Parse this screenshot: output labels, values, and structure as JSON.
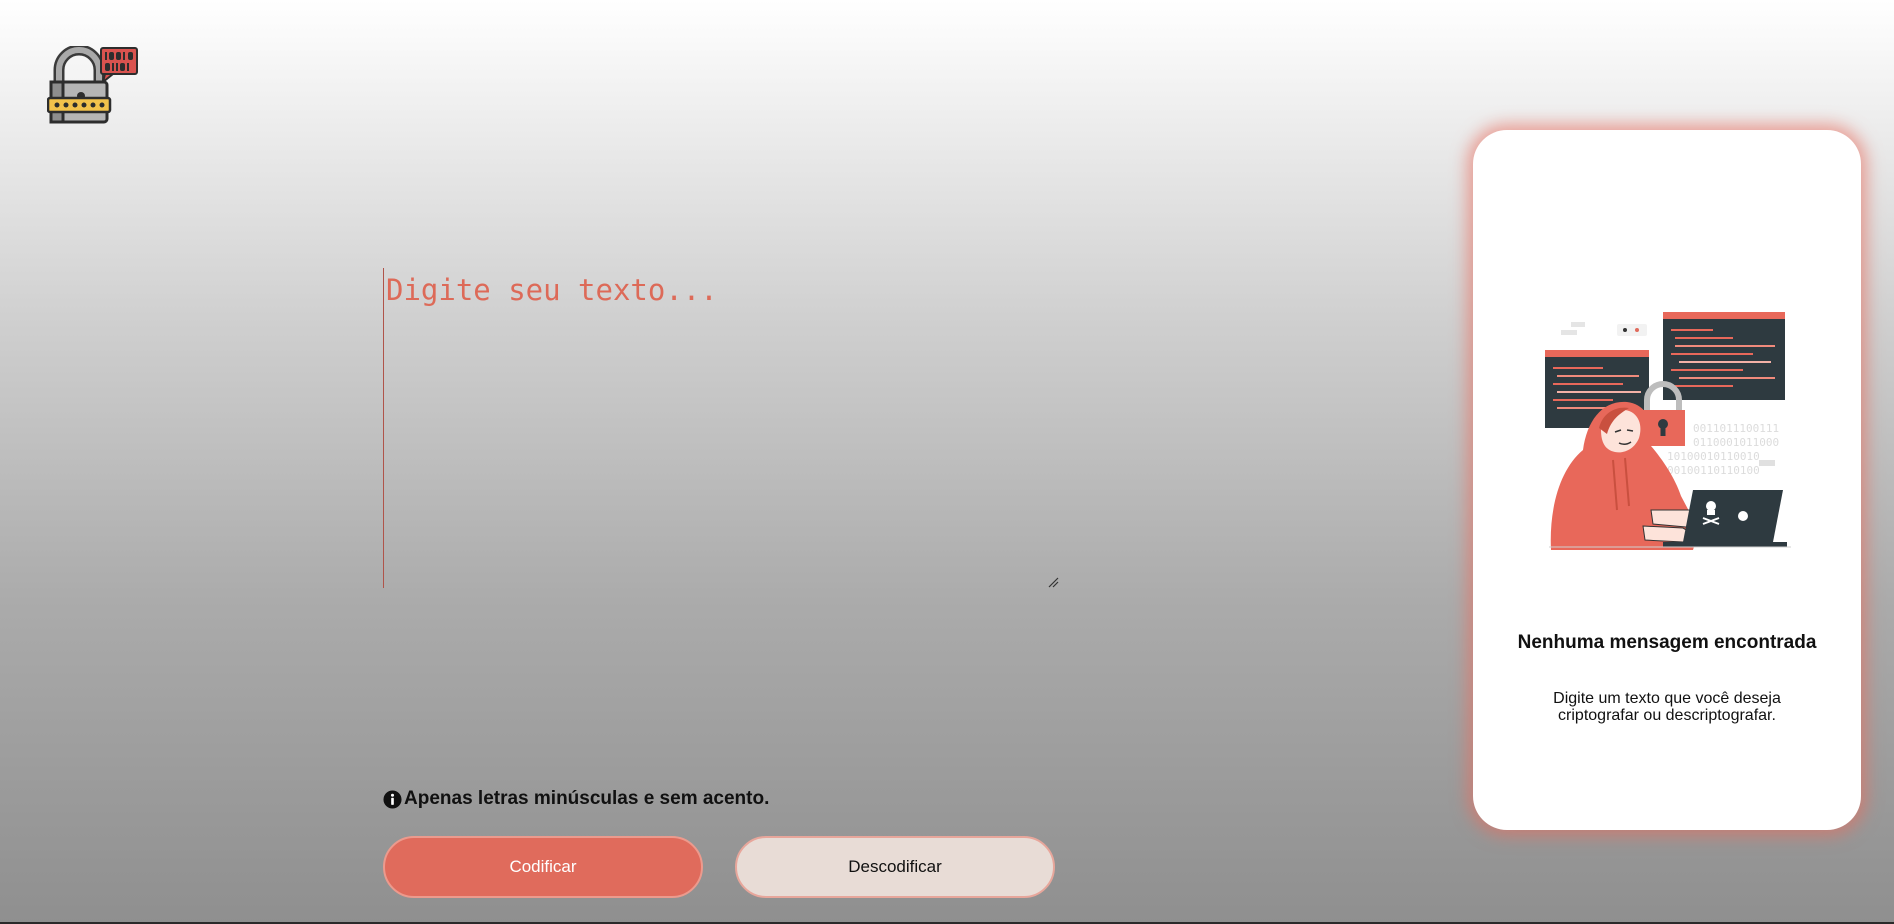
{
  "app": {
    "logo_icon": "padlock-binary-icon"
  },
  "input": {
    "placeholder": "Digite seu texto...",
    "value": ""
  },
  "notice": {
    "icon": "info-icon",
    "text": "Apenas letras minúsculas e sem acento."
  },
  "buttons": {
    "encode_label": "Codificar",
    "decode_label": "Descodificar"
  },
  "output_panel": {
    "illustration": "hacker-with-lock-illustration",
    "title": "Nenhuma mensagem encontrada",
    "message": "Digite um texto que você deseja criptografar ou descriptografar."
  },
  "colors": {
    "accent": "#e06b5c",
    "decode_button_bg": "#e8dcd6",
    "panel_glow": "#e86e5f"
  }
}
